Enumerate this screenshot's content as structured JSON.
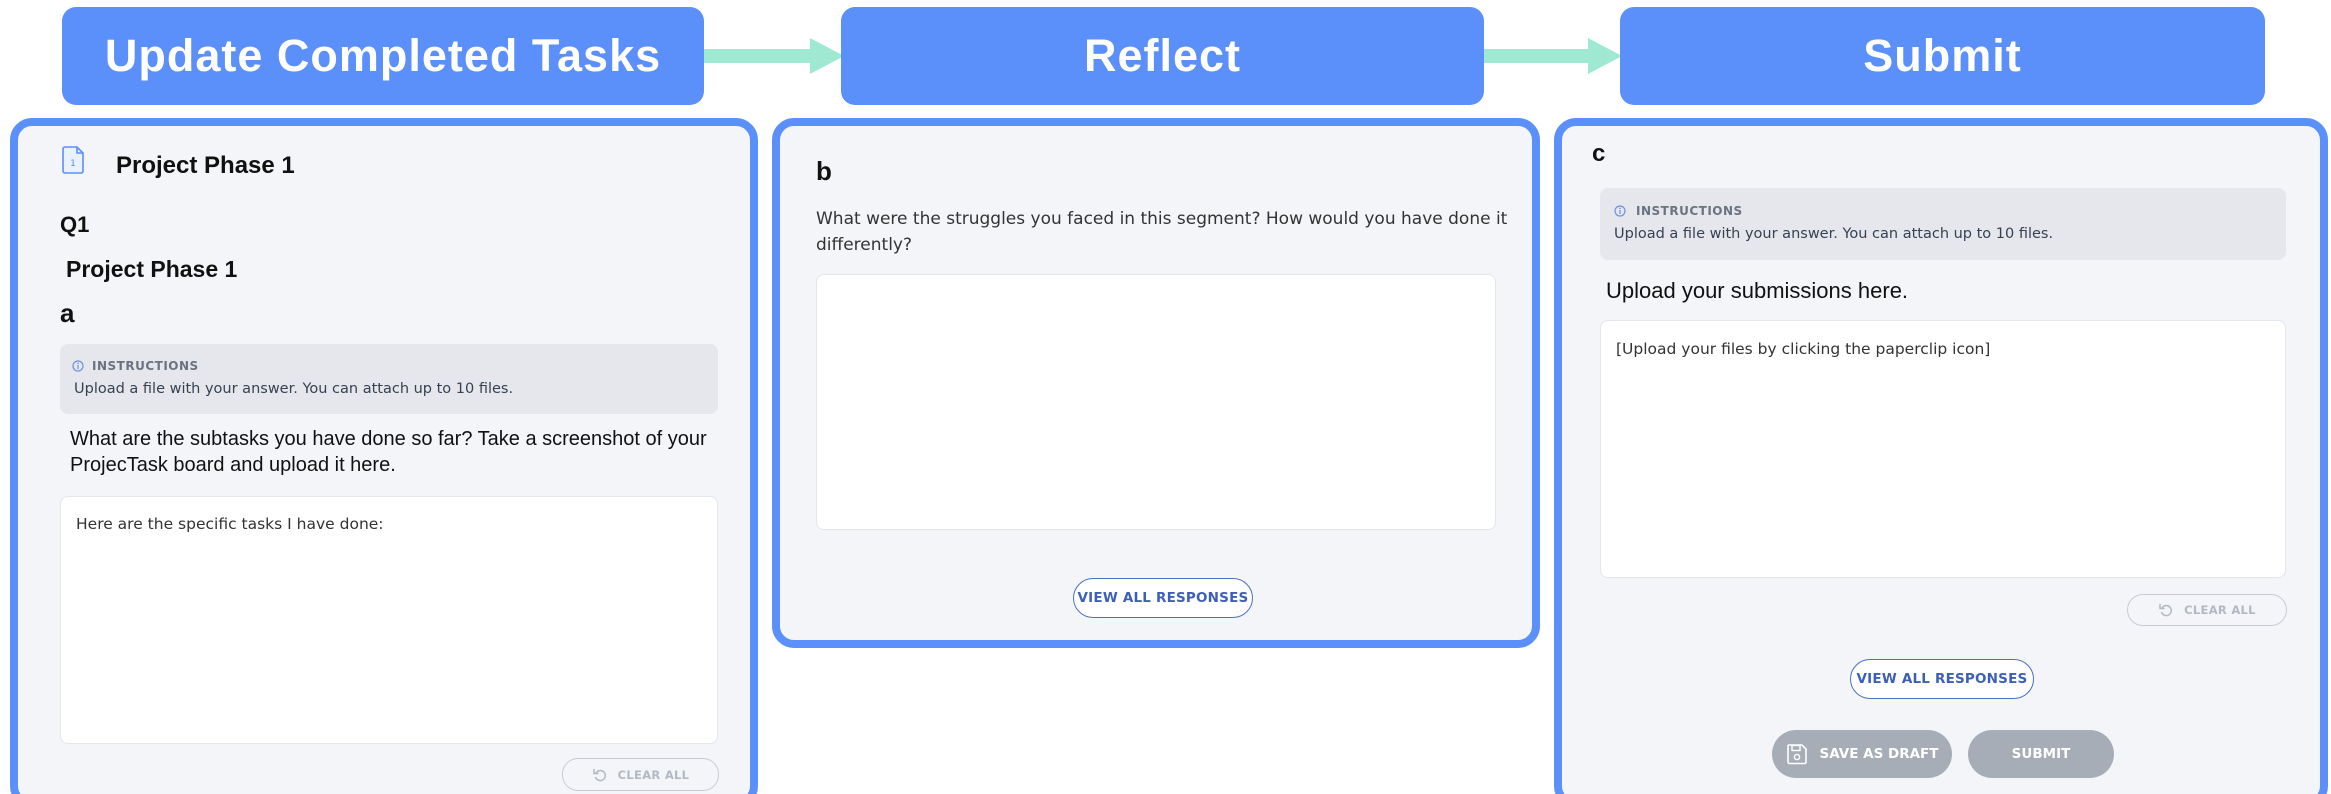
{
  "colors": {
    "accent": "#5b8ff9",
    "arrow": "#9fe8d2",
    "panel_bg": "#f3f5f9",
    "button_border": "#4a6fc7",
    "disabled_button": "#a6adb7"
  },
  "steps": [
    {
      "label": "Update Completed Tasks"
    },
    {
      "label": "Reflect"
    },
    {
      "label": "Submit"
    }
  ],
  "panel1": {
    "doc_icon": "document-icon",
    "title": "Project Phase 1",
    "question_number": "Q1",
    "subtitle": "Project Phase 1",
    "part_letter": "a",
    "instructions": {
      "icon": "info-icon",
      "label": "INSTRUCTIONS",
      "text": "Upload a file with your answer. You can attach up to 10 files."
    },
    "question_line1": "What are the subtasks you have done so far? Take a screenshot of your",
    "question_line2": "ProjecTask board and upload it here.",
    "answer_text": "Here are the specific tasks I have done:",
    "clear_all": {
      "icon": "undo-icon",
      "label": "CLEAR ALL"
    }
  },
  "panel2": {
    "part_letter": "b",
    "question_line1": "What were the struggles you faced in this segment? How would you have done it",
    "question_line2": "differently?",
    "answer_text": "",
    "view_all": "VIEW ALL RESPONSES"
  },
  "panel3": {
    "part_letter": "c",
    "instructions": {
      "icon": "info-icon",
      "label": "INSTRUCTIONS",
      "text": "Upload a file with your answer. You can attach up to 10 files."
    },
    "prompt": "Upload your submissions here.",
    "answer_text": "[Upload your files by clicking the paperclip icon]",
    "clear_all": {
      "icon": "undo-icon",
      "label": "CLEAR ALL"
    },
    "view_all": "VIEW ALL RESPONSES",
    "save_draft": {
      "icon": "save-icon",
      "label": "SAVE AS DRAFT"
    },
    "submit": "SUBMIT"
  }
}
